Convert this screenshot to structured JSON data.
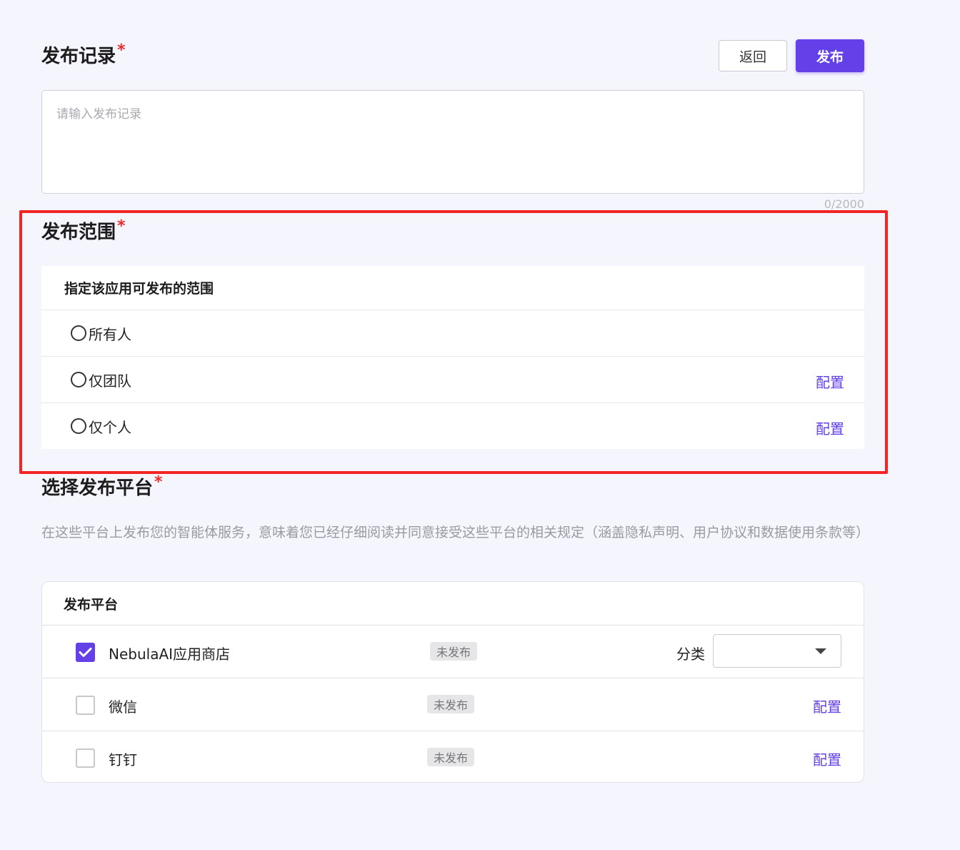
{
  "record": {
    "title": "发布记录",
    "required_mark": "*",
    "back_label": "返回",
    "publish_label": "发布",
    "placeholder": "请输入发布记录",
    "counter": "0/2000"
  },
  "scope": {
    "title": "发布范围",
    "required_mark": "*",
    "panel_header": "指定该应用可发布的范围",
    "options": [
      {
        "label": "所有人",
        "config": ""
      },
      {
        "label": "仅团队",
        "config": "配置"
      },
      {
        "label": "仅个人",
        "config": "配置"
      }
    ]
  },
  "platform": {
    "title": "选择发布平台",
    "required_mark": "*",
    "description": "在这些平台上发布您的智能体服务，意味着您已经仔细阅读并同意接受这些平台的相关规定（涵盖隐私声明、用户协议和数据使用条款等）",
    "panel_header": "发布平台",
    "category_label": "分类",
    "category_value": "",
    "rows": [
      {
        "name": "NebulaAI应用商店",
        "status": "未发布",
        "checked": true,
        "config": ""
      },
      {
        "name": "微信",
        "status": "未发布",
        "checked": false,
        "config": "配置"
      },
      {
        "name": "钉钉",
        "status": "未发布",
        "checked": false,
        "config": "配置"
      }
    ]
  },
  "colors": {
    "accent": "#6340e8",
    "highlight_border": "#f22424",
    "required": "#f02b2b",
    "background": "#f5f5fd"
  },
  "icons": [
    "radio-empty-icon",
    "checkbox-checked-icon",
    "checkbox-empty-icon",
    "chevron-down-icon"
  ]
}
